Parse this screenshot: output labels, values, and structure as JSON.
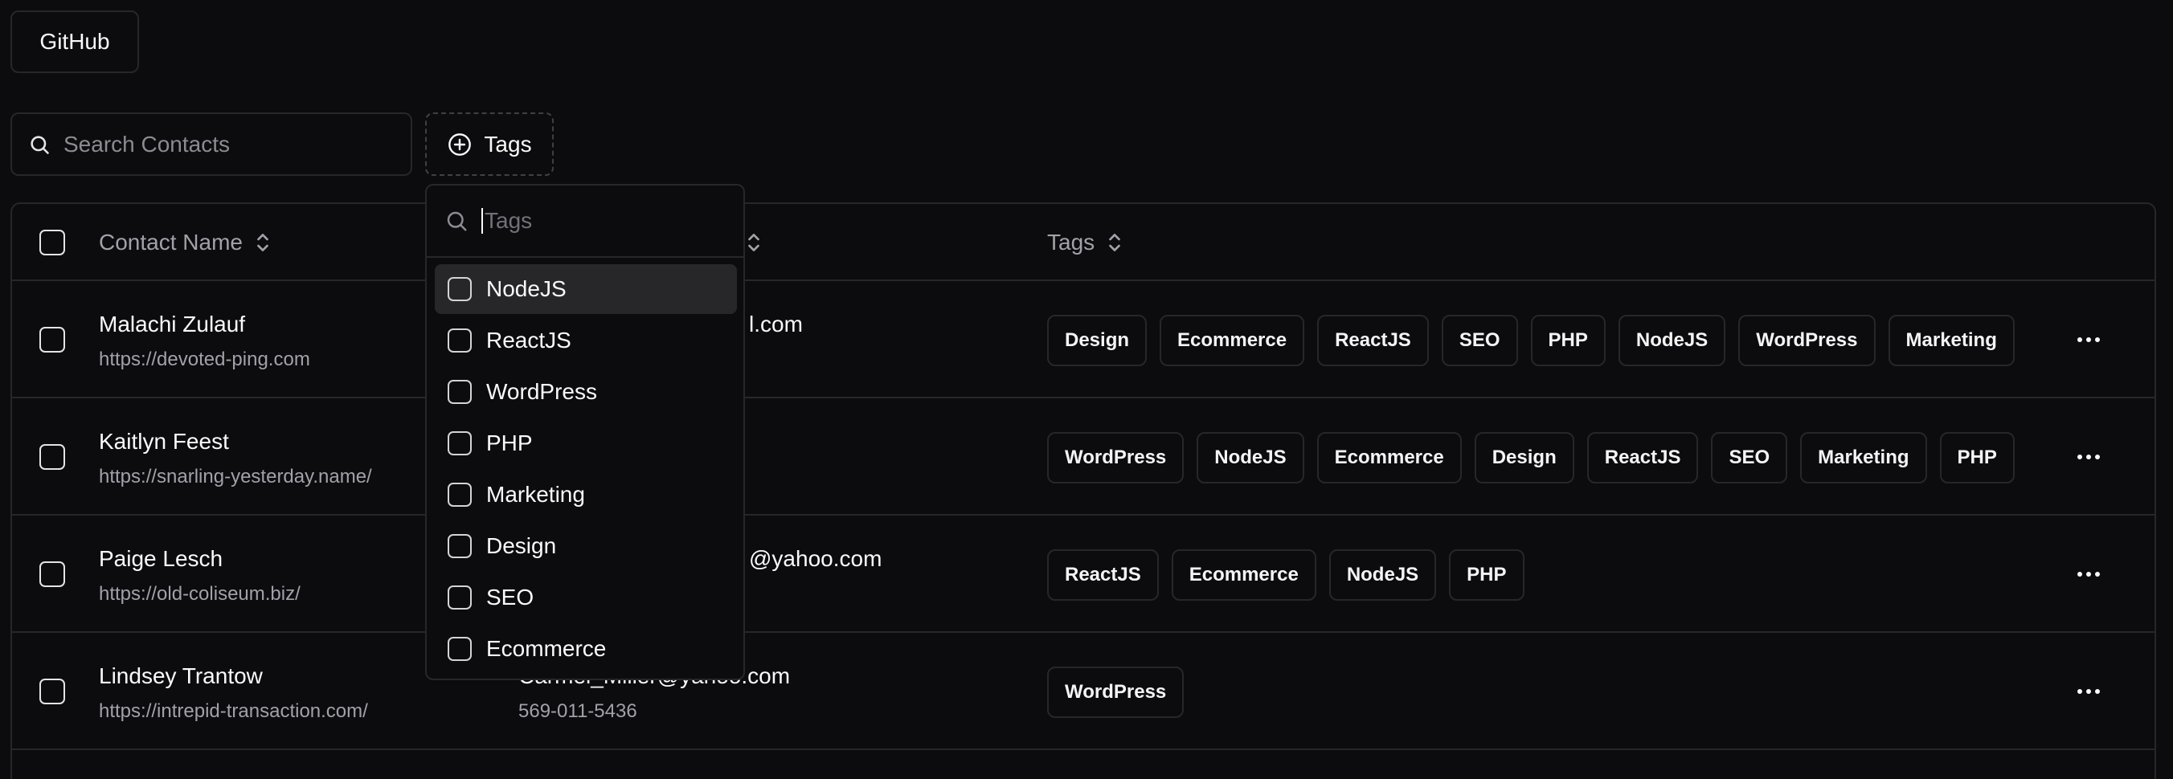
{
  "header": {
    "github_label": "GitHub"
  },
  "toolbar": {
    "search_placeholder": "Search Contacts",
    "tags_filter_label": "Tags"
  },
  "table": {
    "columns": {
      "contact_name": "Contact Name",
      "tags": "Tags"
    },
    "rows": [
      {
        "name": "Malachi Zulauf",
        "url": "https://devoted-ping.com",
        "email_visible": "l.com",
        "phone": "",
        "tags": [
          "Design",
          "Ecommerce",
          "ReactJS",
          "SEO",
          "PHP",
          "NodeJS",
          "WordPress",
          "Marketing"
        ]
      },
      {
        "name": "Kaitlyn Feest",
        "url": "https://snarling-yesterday.name/",
        "email_visible": "",
        "phone": "",
        "tags": [
          "WordPress",
          "NodeJS",
          "Ecommerce",
          "Design",
          "ReactJS",
          "SEO",
          "Marketing",
          "PHP"
        ]
      },
      {
        "name": "Paige Lesch",
        "url": "https://old-coliseum.biz/",
        "email_visible": "@yahoo.com",
        "phone": "",
        "tags": [
          "ReactJS",
          "Ecommerce",
          "NodeJS",
          "PHP"
        ]
      },
      {
        "name": "Lindsey Trantow",
        "url": "https://intrepid-transaction.com/",
        "email_visible": "Carmel_Miller@yahoo.com",
        "phone": "569-011-5436",
        "tags": [
          "WordPress"
        ]
      }
    ]
  },
  "tags_popover": {
    "search_placeholder": "Tags",
    "options": [
      {
        "label": "NodeJS",
        "checked": false
      },
      {
        "label": "ReactJS",
        "checked": false
      },
      {
        "label": "WordPress",
        "checked": false
      },
      {
        "label": "PHP",
        "checked": false
      },
      {
        "label": "Marketing",
        "checked": false
      },
      {
        "label": "Design",
        "checked": false
      },
      {
        "label": "SEO",
        "checked": false
      },
      {
        "label": "Ecommerce",
        "checked": false
      }
    ]
  }
}
